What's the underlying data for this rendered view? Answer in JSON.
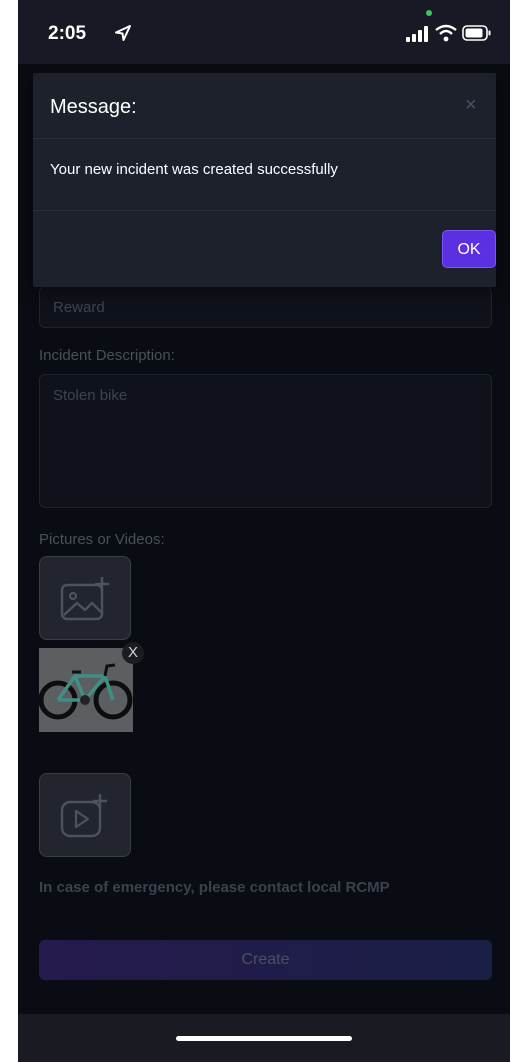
{
  "status_bar": {
    "time": "2:05"
  },
  "form": {
    "reward_placeholder": "Reward",
    "description_label": "Incident Description:",
    "description_value": "Stolen bike",
    "media_label": "Pictures or Videos:",
    "remove_label": "X",
    "emergency_note": "In case of emergency, please contact local RCMP",
    "create_label": "Create"
  },
  "modal": {
    "title": "Message:",
    "close_glyph": "×",
    "message": "Your new incident was created successfully",
    "ok_label": "OK"
  },
  "colors": {
    "accent": "#5b30e0",
    "background": "#0a0c13",
    "modal": "#1d212c"
  }
}
